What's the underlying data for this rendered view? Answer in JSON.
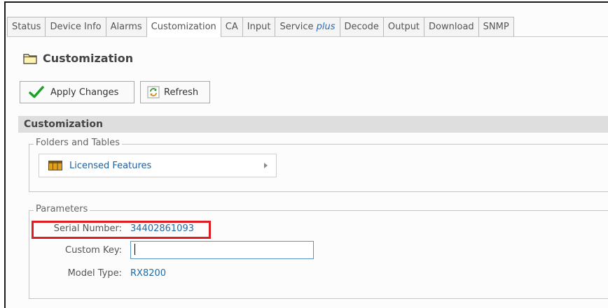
{
  "tabs": [
    {
      "label": "Status"
    },
    {
      "label": "Device Info"
    },
    {
      "label": "Alarms"
    },
    {
      "label": "Customization",
      "active": true
    },
    {
      "label": "CA"
    },
    {
      "label": "Input"
    },
    {
      "label": "Service ",
      "suffix": "plus"
    },
    {
      "label": "Decode"
    },
    {
      "label": "Output"
    },
    {
      "label": "Download"
    },
    {
      "label": "SNMP"
    }
  ],
  "page": {
    "title": "Customization",
    "icon": "folder-icon"
  },
  "toolbar": {
    "apply_label": "Apply Changes",
    "apply_icon": "checkmark-icon",
    "refresh_label": "Refresh",
    "refresh_icon": "refresh-icon"
  },
  "section": {
    "title": "Customization"
  },
  "folders": {
    "legend": "Folders and Tables",
    "items": [
      {
        "label": "Licensed Features",
        "icon": "table-icon"
      }
    ]
  },
  "parameters": {
    "legend": "Parameters",
    "serial_number": {
      "label": "Serial Number:",
      "value": "34402861093"
    },
    "custom_key": {
      "label": "Custom Key:",
      "value": ""
    },
    "model_type": {
      "label": "Model Type:",
      "value": "RX8200"
    }
  },
  "colors": {
    "accent_link": "#1f6aa5",
    "highlight_border": "#e11b22",
    "section_bg": "#dedede",
    "checkmark": "#1aa12a"
  }
}
